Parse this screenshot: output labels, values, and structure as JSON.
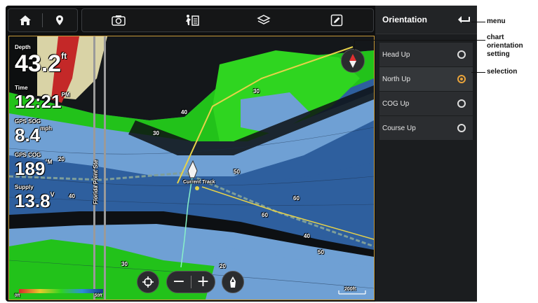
{
  "overlay": {
    "depth_label": "Depth",
    "depth_value": "43.2",
    "depth_unit": "ft",
    "time_label": "Time",
    "time_value": "12:21",
    "time_ampm": "PM",
    "sog_label": "GPS SOG",
    "sog_value": "8.4",
    "sog_unit": "mph",
    "cog_label": "GPS COG",
    "cog_value": "189",
    "cog_unit": "°M",
    "supply_label": "Supply",
    "supply_value": "13.8",
    "supply_unit": "V"
  },
  "chart": {
    "current_track_label": "Current Track",
    "channel_label": "Florida Point Ste",
    "depth_scale_min": "0ft",
    "depth_scale_max": "50ft",
    "scale_bar": "200ft",
    "contour_labels": [
      "20",
      "30",
      "40",
      "50",
      "60",
      "40",
      "30",
      "20",
      "40",
      "50",
      "60",
      "30"
    ]
  },
  "menu": {
    "title": "Orientation",
    "items": [
      {
        "label": "Head Up",
        "selected": false
      },
      {
        "label": "North Up",
        "selected": true
      },
      {
        "label": "COG Up",
        "selected": false
      },
      {
        "label": "Course Up",
        "selected": false
      }
    ]
  },
  "callouts": {
    "menu": "menu",
    "chart_orientation": "chart orientation setting",
    "chart_orientation_lines": [
      "chart",
      "orientation",
      "setting"
    ],
    "selection": "selection"
  },
  "colors": {
    "accent": "#e8a33a",
    "deep_water": "#2e5f9e",
    "shallow_water": "#6fa0d4",
    "land_green": "#22c21a",
    "track": "#e6d24a"
  },
  "icons": [
    "home-icon",
    "waypoint-icon",
    "camera-icon",
    "man-overboard-icon",
    "layers-icon",
    "edit-icon",
    "back-arrow-icon",
    "compass-icon",
    "crosshair-icon",
    "boat-icon"
  ]
}
